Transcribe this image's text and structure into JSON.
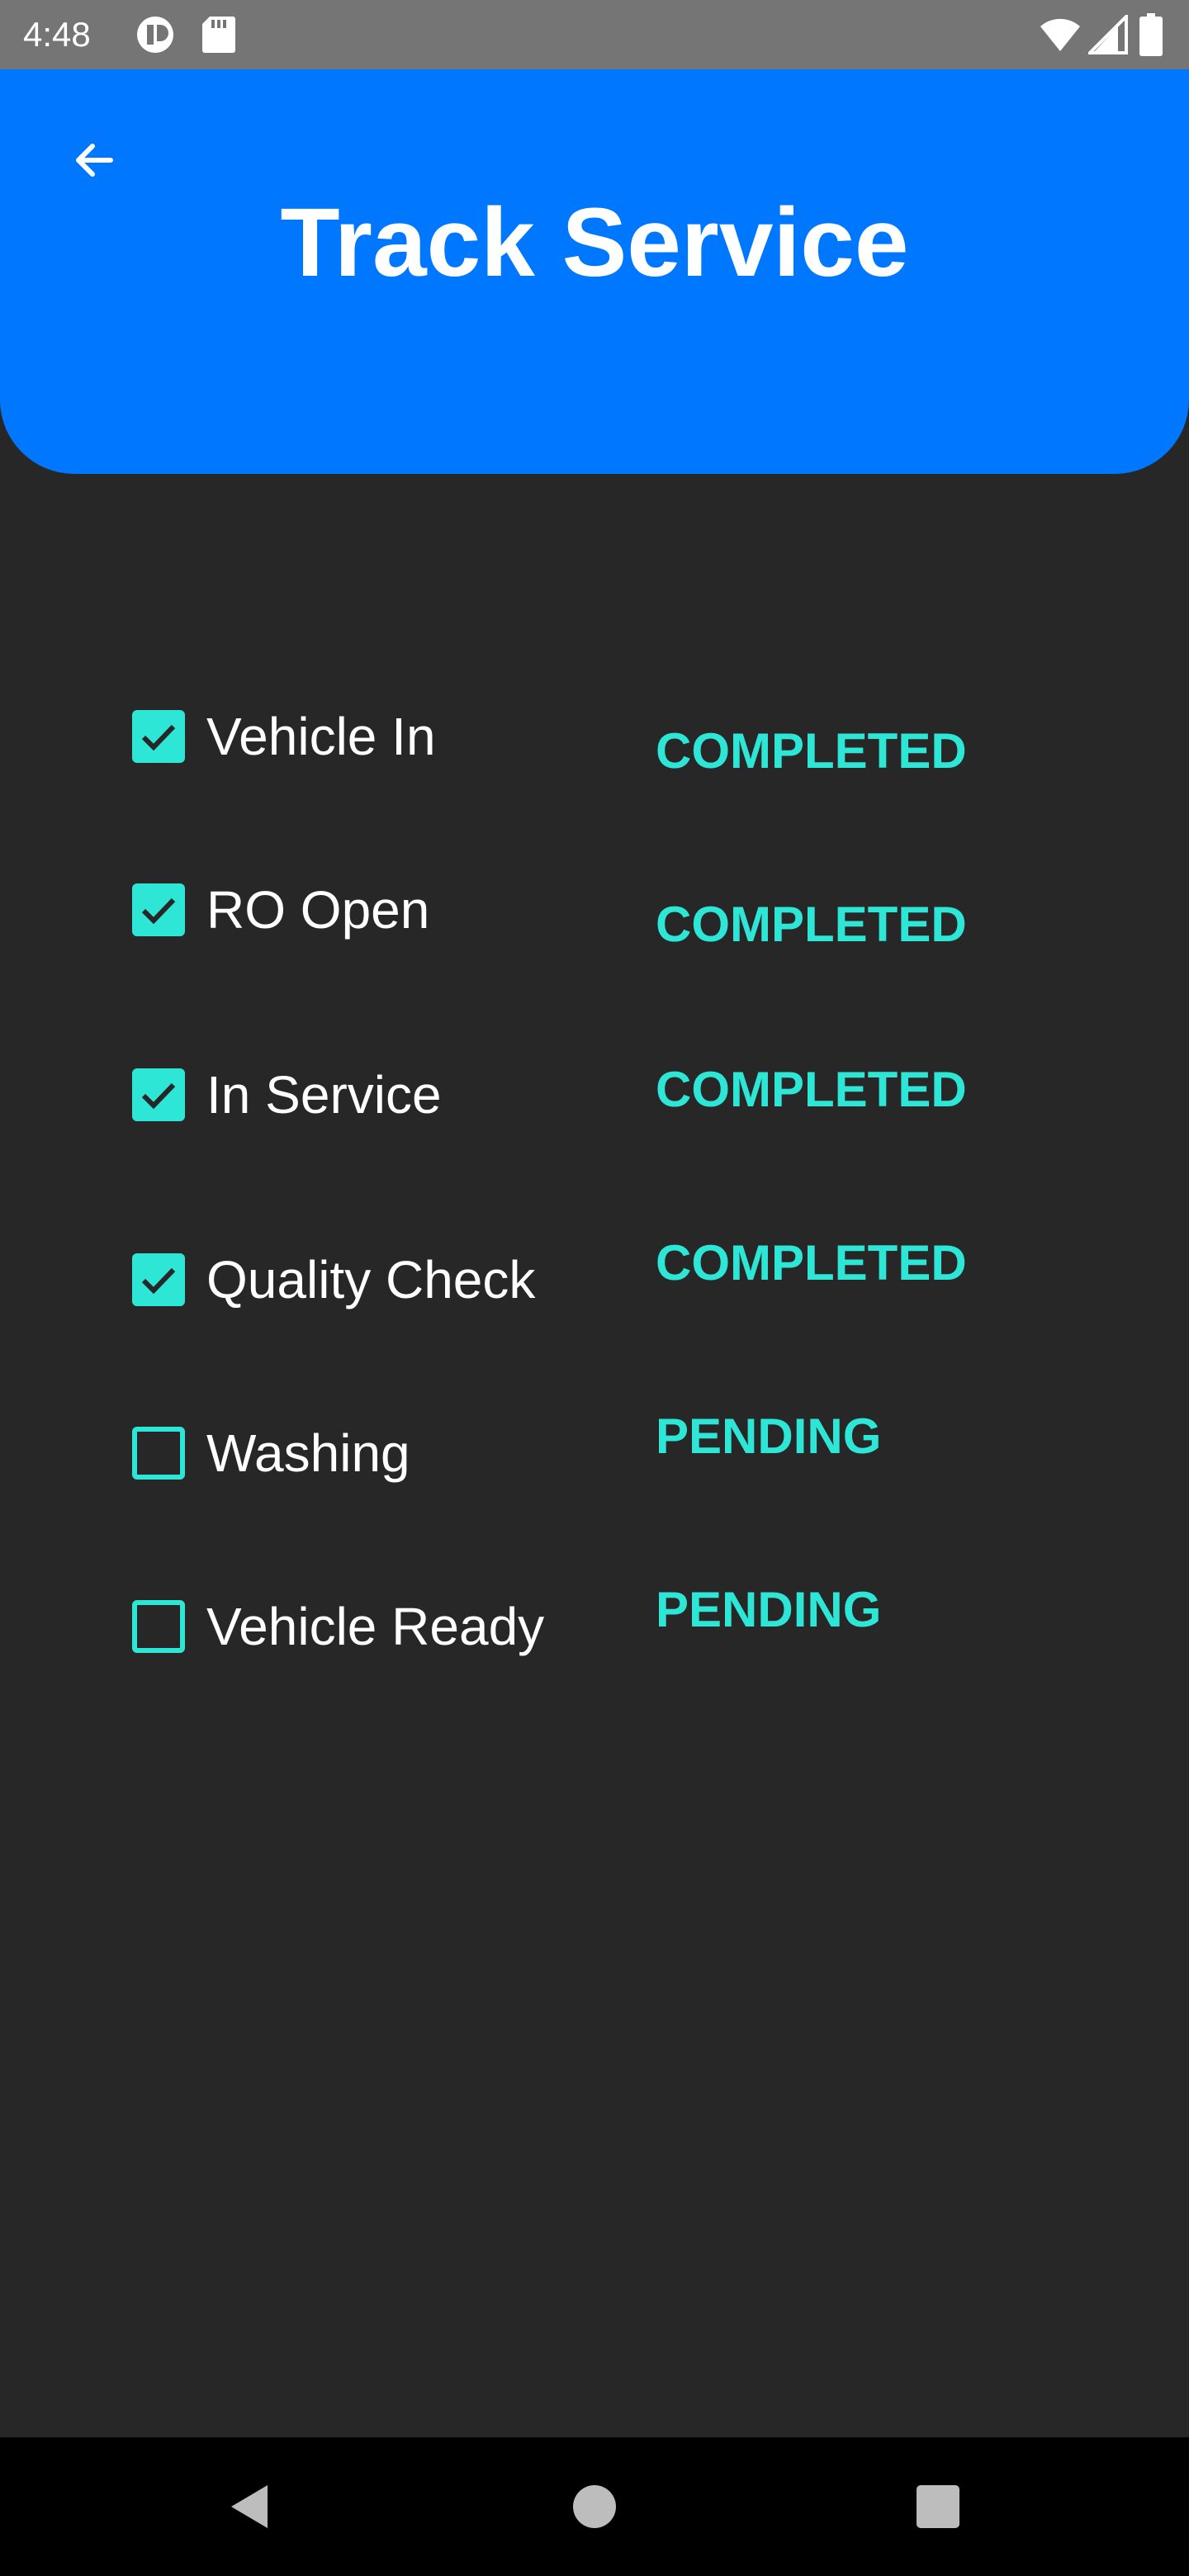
{
  "status_bar": {
    "time": "4:48",
    "icons": [
      "notification-app-icon",
      "sd-card-icon",
      "wifi-icon",
      "cell-signal-icon",
      "battery-icon"
    ]
  },
  "app_bar": {
    "title": "Track Service",
    "back_icon": "arrow-back-icon",
    "color": "#0077ff"
  },
  "steps": [
    {
      "label": "Vehicle In",
      "checked": true,
      "status": "COMPLETED"
    },
    {
      "label": "RO Open",
      "checked": true,
      "status": "COMPLETED"
    },
    {
      "label": "In Service",
      "checked": true,
      "status": "COMPLETED"
    },
    {
      "label": "Quality Check",
      "checked": true,
      "status": "COMPLETED"
    },
    {
      "label": "Washing",
      "checked": false,
      "status": "PENDING"
    },
    {
      "label": "Vehicle Ready",
      "checked": false,
      "status": "PENDING"
    }
  ],
  "colors": {
    "accent": "#2ee6d6",
    "background": "#272727",
    "app_bar": "#0077ff"
  },
  "nav_bar": {
    "icons": [
      "nav-back-icon",
      "nav-home-icon",
      "nav-recents-icon"
    ]
  }
}
